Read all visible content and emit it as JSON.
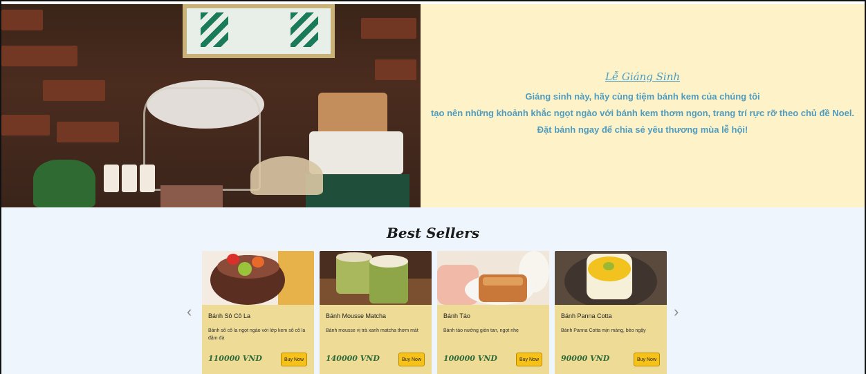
{
  "hero": {
    "title": "Lễ Giáng Sinh",
    "lines": [
      "Giáng sinh này, hãy cùng tiệm bánh kem của chúng tôi",
      "tạo nên những khoảnh khắc ngọt ngào với bánh kem thơm ngon, trang trí rực rỡ theo chủ đề Noel.",
      "Đặt bánh ngay để chia sẻ yêu thương mùa lễ hội!"
    ]
  },
  "best_sellers": {
    "title": "Best Sellers",
    "prev_arrow": "‹",
    "next_arrow": "›",
    "products": [
      {
        "name": "Bánh Sô Cô La",
        "description": "Bánh sô cô la ngọt ngào với lớp kem sô cô la đậm đà",
        "price": "110000 VND",
        "button": "Buy Now"
      },
      {
        "name": "Bánh Mousse Matcha",
        "description": "Bánh mousse vị trà xanh matcha thơm mát",
        "price": "140000 VND",
        "button": "Buy Now"
      },
      {
        "name": "Bánh Táo",
        "description": "Bánh táo nướng giòn tan, ngọt nhẹ",
        "price": "100000 VND",
        "button": "Buy Now"
      },
      {
        "name": "Bánh Panna Cotta",
        "description": "Bánh Panna Cotta mịn màng, béo ngậy",
        "price": "90000 VND",
        "button": "Buy Now"
      }
    ]
  },
  "colors": {
    "hero_text_bg": "#fdf2c8",
    "hero_text": "#4e9cbf",
    "section_bg": "#eef5fc",
    "card_bg": "#eddb96",
    "button_bg": "#f6c21a",
    "price": "#2f6a3a"
  }
}
